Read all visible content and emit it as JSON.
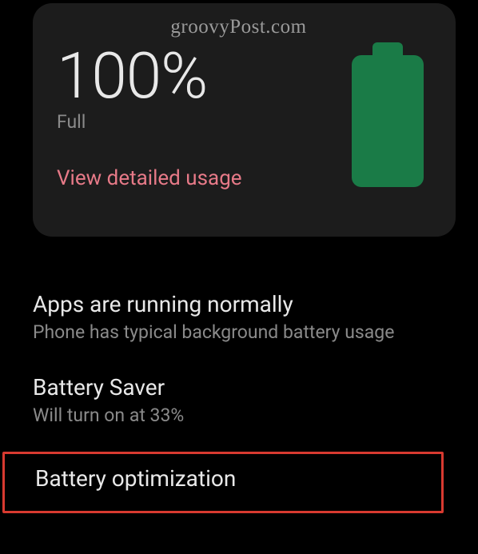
{
  "watermark": "groovyPost.com",
  "card": {
    "percent": "100%",
    "status": "Full",
    "detailed_link": "View detailed usage",
    "battery_color": "#1a7b47"
  },
  "items": {
    "apps": {
      "title": "Apps are running normally",
      "sub": "Phone has typical background battery usage"
    },
    "saver": {
      "title": "Battery Saver",
      "sub": "Will turn on at 33%"
    },
    "optimization": {
      "title": "Battery optimization"
    }
  }
}
